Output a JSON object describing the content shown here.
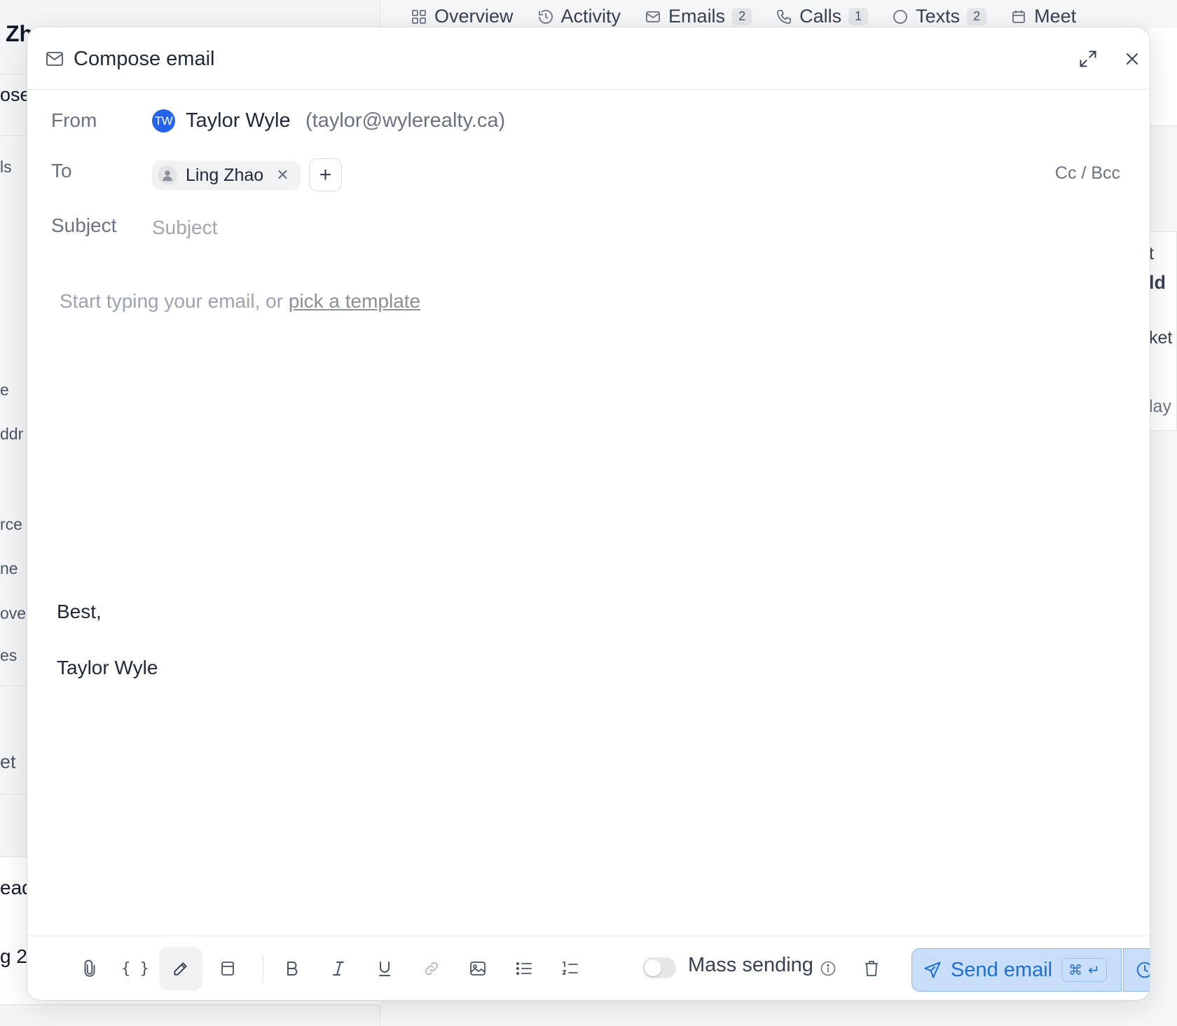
{
  "background": {
    "contact_title_fragment": "Zh",
    "left_fragments": [
      "ose",
      "ls",
      "e",
      "ddr",
      "rce",
      "ne",
      "ove",
      "es",
      "et",
      "ead",
      "g 2"
    ],
    "tabs": [
      {
        "label": "Overview",
        "icon": "overview-icon",
        "badge": ""
      },
      {
        "label": "Activity",
        "icon": "history-icon",
        "badge": ""
      },
      {
        "label": "Emails",
        "icon": "mail-icon",
        "badge": "2"
      },
      {
        "label": "Calls",
        "icon": "phone-icon",
        "badge": "1"
      },
      {
        "label": "Texts",
        "icon": "chat-icon",
        "badge": "2"
      },
      {
        "label": "Meet",
        "icon": "calendar-icon",
        "badge": ""
      }
    ],
    "right_fragments": [
      "t",
      "ld",
      "ket",
      "lay"
    ]
  },
  "compose": {
    "title": "Compose email",
    "from_label": "From",
    "from_initials": "TW",
    "from_name": "Taylor Wyle",
    "from_email": "(taylor@wylerealty.ca)",
    "to_label": "To",
    "to_recipients": [
      {
        "name": "Ling Zhao"
      }
    ],
    "add_recipient": "+",
    "cc_bcc": "Cc / Bcc",
    "subject_label": "Subject",
    "subject_placeholder": "Subject",
    "subject_value": "",
    "body_placeholder_prefix": "Start typing your email, or ",
    "body_template_link": "pick a template",
    "signature_greeting": "Best,",
    "signature_name": "Taylor Wyle"
  },
  "toolbar": {
    "mass_sending_label": "Mass sending",
    "mass_sending_enabled": false,
    "send_label": "Send email",
    "shortcut_cmd": "⌘",
    "shortcut_enter": "↵"
  },
  "colors": {
    "avatar": "#2563eb",
    "send_bg": "#c9def9",
    "send_text": "#1f6fd6",
    "send_border": "#8db6ee"
  }
}
